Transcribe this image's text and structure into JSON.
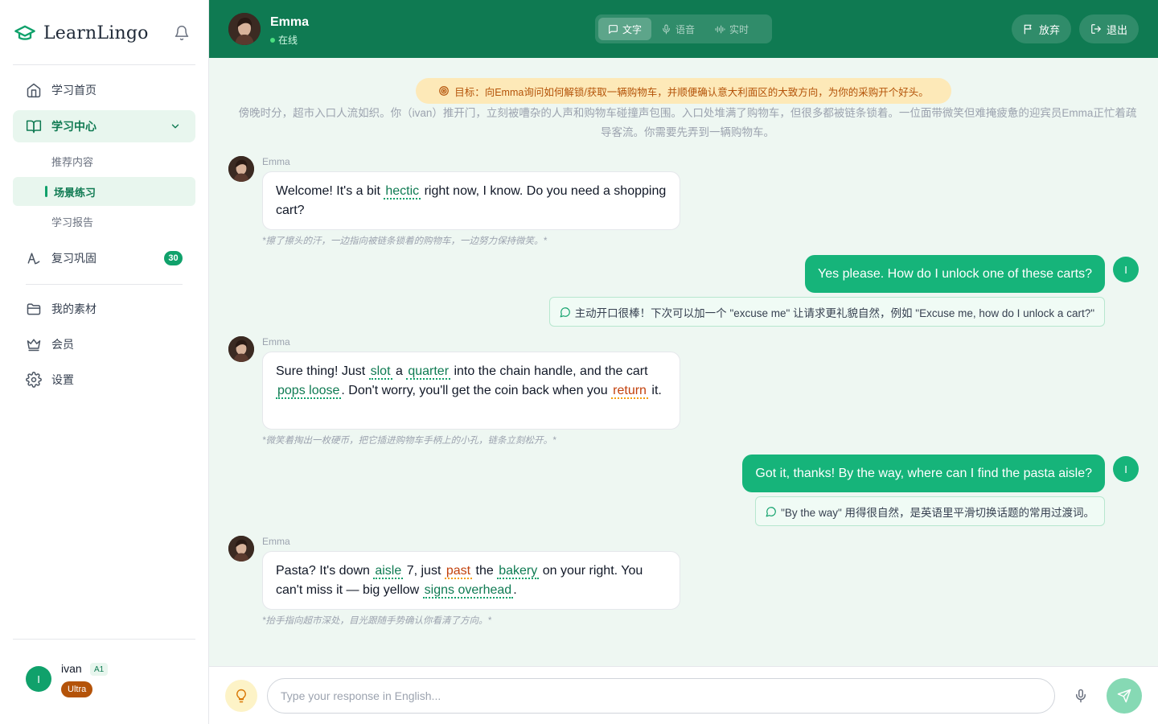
{
  "brand": {
    "name": "LearnLingo"
  },
  "nav": {
    "home": "学习首页",
    "center": "学习中心",
    "recommended": "推荐内容",
    "scene_practice": "场景练习",
    "report": "学习报告",
    "review": "复习巩固",
    "review_count": "30",
    "materials": "我的素材",
    "membership": "会员",
    "settings": "设置"
  },
  "user": {
    "initial": "I",
    "name": "ivan",
    "level": "A1",
    "plan": "Ultra"
  },
  "header": {
    "character_name": "Emma",
    "status": "在线",
    "modes": [
      "文字",
      "语音",
      "实时"
    ],
    "active_mode": "文字",
    "give_up": "放弃",
    "exit": "退出"
  },
  "chat": {
    "goal": "目标：向Emma询问如何解锁/获取一辆购物车，并顺便确认意大利面区的大致方向，为你的采购开个好头。",
    "scene": "傍晚时分，超市入口人流如织。你（ivan）推开门，立刻被嘈杂的人声和购物车碰撞声包围。入口处堆满了购物车，但很多都被链条锁着。一位面带微笑但难掩疲惫的迎宾员Emma正忙着疏导客流。你需要先弄到一辆购物车。",
    "messages": [
      {
        "speaker": "Emma",
        "parts": [
          "Welcome! It's a bit ",
          "hectic",
          " right now, I know. Do you need a shopping cart?"
        ],
        "action": "*擦了擦头的汗，一边指向被链条锁着的购物车，一边努力保持微笑。*"
      },
      {
        "user_text": "Yes please. How do I unlock one of these carts?",
        "feedback": "主动开口很棒！下次可以加一个 \"excuse me\" 让请求更礼貌自然，例如 \"Excuse me, how do I unlock a cart?\""
      },
      {
        "speaker": "Emma",
        "parts": [
          "Sure thing! Just ",
          "slot",
          " a ",
          "quarter",
          " into the chain handle, and the cart ",
          "pops loose",
          ". Don't worry, you'll get the coin back when you ",
          "return",
          " it."
        ],
        "action": "*微笑着掏出一枚硬币，把它插进购物车手柄上的小孔，链条立刻松开。*"
      },
      {
        "user_text": "Got it, thanks! By the way, where can I find the pasta aisle?",
        "feedback": "\"By the way\" 用得很自然，是英语里平滑切换话题的常用过渡词。"
      },
      {
        "speaker": "Emma",
        "parts": [
          "Pasta? It's down ",
          "aisle",
          " 7, just ",
          "past",
          " the ",
          "bakery",
          " on your right. You can't miss it — big yellow ",
          "signs overhead",
          "."
        ],
        "action": "*抬手指向超市深处，目光跟随手势确认你看清了方向。*"
      }
    ]
  },
  "composer": {
    "placeholder": "Type your response in English..."
  },
  "icons": {
    "logo": "graduation-cap-icon",
    "bell": "bell-icon",
    "home": "home-icon",
    "book": "book-open-icon",
    "review": "language-icon",
    "folder": "folder-icon",
    "crown": "crown-icon",
    "gear": "gear-icon",
    "target": "target-icon",
    "chat": "message-icon",
    "flag": "flag-icon",
    "logout": "logout-icon",
    "bulb": "lightbulb-icon",
    "mic": "microphone-icon",
    "send": "send-icon"
  },
  "colors": {
    "primary": "#0f7a52",
    "accent": "#16b47a",
    "goal_bg": "#fde9b8",
    "goal_text": "#b45309",
    "plan_bg": "#b45309"
  }
}
